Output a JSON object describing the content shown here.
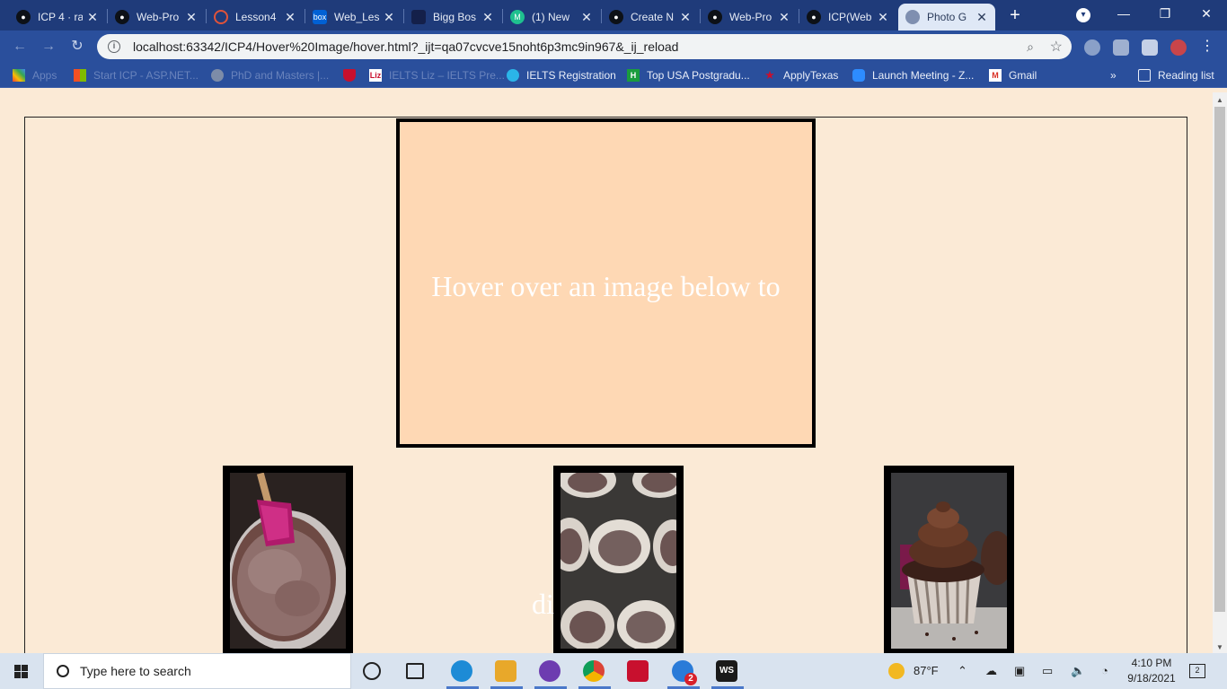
{
  "tabs": [
    {
      "title": "ICP 4 · ra",
      "icon": "github-icon"
    },
    {
      "title": "Web-Pro",
      "icon": "github-icon"
    },
    {
      "title": "Lesson4",
      "icon": "loading-icon"
    },
    {
      "title": "Web_Les",
      "icon": "box-icon",
      "favtext": "box"
    },
    {
      "title": "Bigg Bos",
      "icon": "bigg-boss-icon"
    },
    {
      "title": "(1) New",
      "icon": "m-icon",
      "favtext": "M"
    },
    {
      "title": "Create N",
      "icon": "github-icon"
    },
    {
      "title": "Web-Pro",
      "icon": "github-icon"
    },
    {
      "title": "ICP(Web",
      "icon": "github-icon"
    },
    {
      "title": "Photo G",
      "icon": "globe-icon"
    }
  ],
  "tab_close": "✕",
  "new_tab": "+",
  "window": {
    "minimize": "—",
    "restore": "❐",
    "close": "✕"
  },
  "toolbar": {
    "back": "←",
    "forward": "→",
    "reload": "↻",
    "url": "localhost:63342/ICP4/Hover%20Image/hover.html?_ijt=qa07cvcve15noht6p3mc9in967&_ij_reload",
    "info": "i",
    "zoom": "⌕",
    "star": "☆"
  },
  "bookmarks": [
    {
      "label": "Apps",
      "icon": "apps-icon",
      "faded": true
    },
    {
      "label": "Start ICP - ASP.NET...",
      "icon": "windows-logo-icon",
      "faded": true
    },
    {
      "label": "PhD and Masters |...",
      "icon": "globe-icon",
      "faded": true
    },
    {
      "label": "",
      "icon": "shield-crest-icon",
      "faded": false
    },
    {
      "label": "IELTS Liz – IELTS Pre...",
      "icon": "liz-icon",
      "favtext": "Liz",
      "faded": true
    },
    {
      "label": "IELTS Registration",
      "icon": "ielts-icon",
      "faded": false
    },
    {
      "label": "Top USA Postgradu...",
      "icon": "h-icon",
      "favtext": "H",
      "faded": false
    },
    {
      "label": "ApplyTexas",
      "icon": "star-icon",
      "faded": false
    },
    {
      "label": "Launch Meeting - Z...",
      "icon": "zoom-icon",
      "faded": false
    },
    {
      "label": "Gmail",
      "icon": "gmail-icon",
      "favtext": "M",
      "faded": false
    }
  ],
  "bookmarks_more": "»",
  "reading_list": "Reading list",
  "page": {
    "display_text": "Hover over an image below to",
    "overflow_text": "di",
    "thumbnails": [
      {
        "alt": "chocolate batter in a bowl with a pink spatula"
      },
      {
        "alt": "cupcake liners with batter in a muffin tin"
      },
      {
        "alt": "chocolate cupcake with chocolate frosting"
      }
    ]
  },
  "taskbar": {
    "search_placeholder": "Type here to search",
    "weather": "87°F",
    "time": "4:10 PM",
    "date": "9/18/2021",
    "notification_count": "2",
    "mail_badge": "2"
  },
  "colors": {
    "page_background": "#fbead6",
    "display_box": "#fed8b4",
    "tab_strip": "#1f3b7a",
    "toolbar": "#2a4f9c"
  }
}
